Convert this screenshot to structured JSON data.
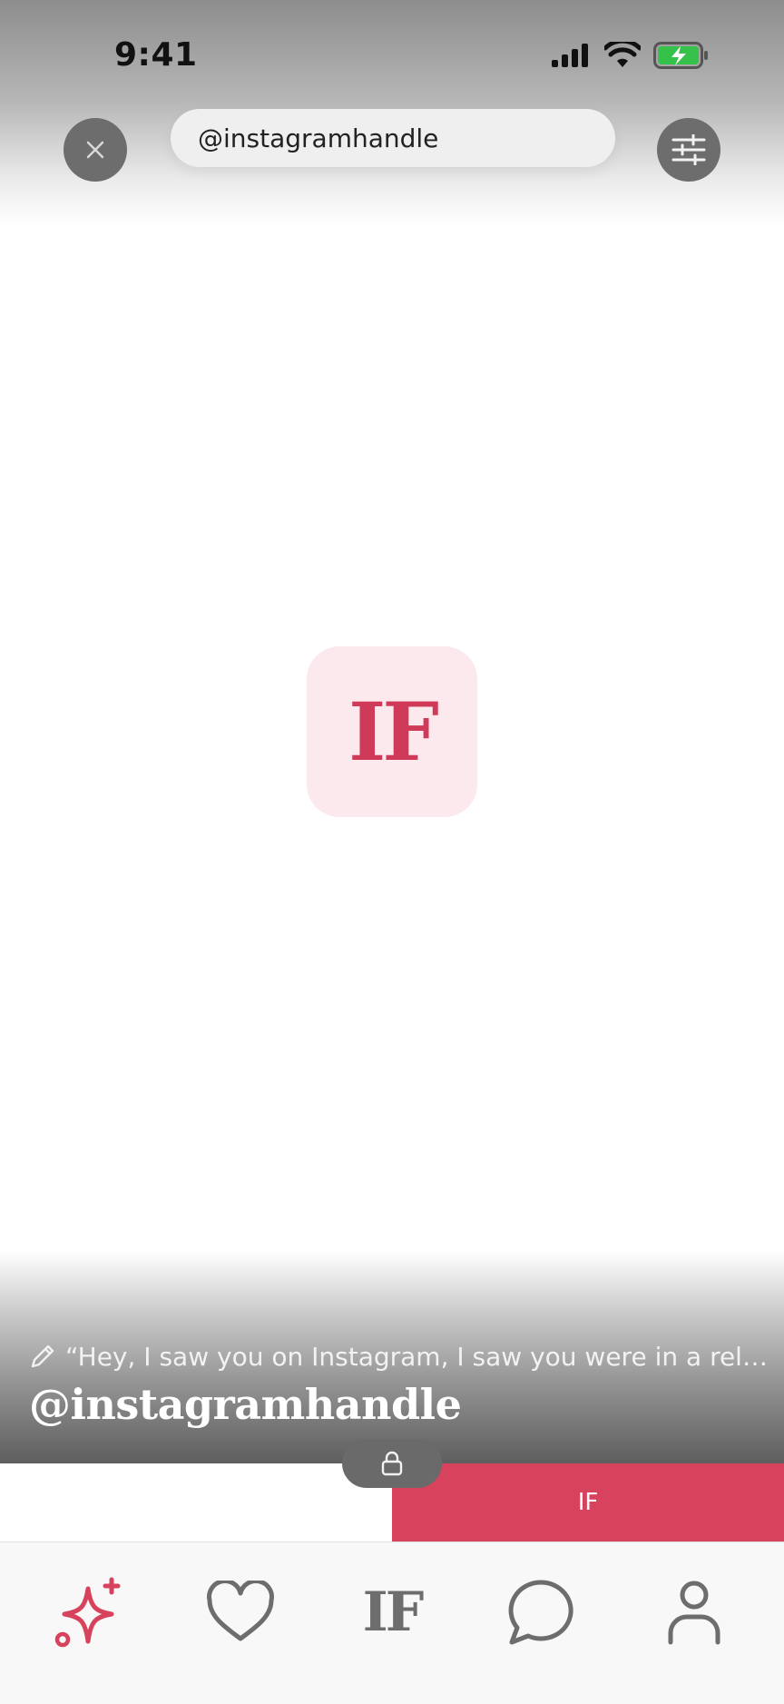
{
  "status_bar": {
    "time": "9:41",
    "icons": [
      "cellular-signal-icon",
      "wifi-icon",
      "battery-charging-icon"
    ],
    "battery_color": "#36c24a"
  },
  "header": {
    "close_icon": "close-icon",
    "search_value": "@instagramhandle",
    "filter_icon": "sliders-icon"
  },
  "center": {
    "logo_text": "IF"
  },
  "profile": {
    "pencil_icon": "pencil-icon",
    "quote": "“Hey, I saw you on Instagram, I saw you were in a relationship…",
    "handle": "@instagramhandle"
  },
  "actions": {
    "lock_icon": "lock-icon",
    "right_label": "IF",
    "accent_color": "#d7425d"
  },
  "tab_bar": {
    "items": [
      {
        "icon": "sparkle-add-icon",
        "active": true
      },
      {
        "icon": "heart-icon",
        "active": false
      },
      {
        "label": "IF",
        "active": false
      },
      {
        "icon": "chat-bubble-icon",
        "active": false
      },
      {
        "icon": "profile-icon",
        "active": false
      }
    ],
    "active_color": "#d7425d",
    "inactive_color": "#6d6d6d"
  }
}
